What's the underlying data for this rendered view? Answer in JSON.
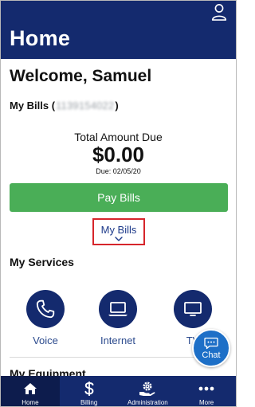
{
  "header": {
    "title": "Home",
    "profile_icon": "person-outline-icon"
  },
  "welcome": "Welcome, Samuel",
  "bills": {
    "section_label": "My Bills (",
    "account_number": "1139154022",
    "section_label_close": ")",
    "total_label": "Total Amount Due",
    "total_amount": "$0.00",
    "due_date": "Due: 02/05/20",
    "pay_button": "Pay Bills",
    "my_bills_link": "My Bills"
  },
  "services": {
    "title": "My Services",
    "items": [
      {
        "label": "Voice",
        "icon": "phone-icon"
      },
      {
        "label": "Internet",
        "icon": "laptop-icon"
      },
      {
        "label": "TV",
        "icon": "tv-icon"
      }
    ]
  },
  "next_section_peek": "My Equipment",
  "chat": {
    "label": "Chat",
    "icon": "chat-bubble-icon"
  },
  "tabbar": {
    "items": [
      {
        "label": "Home",
        "icon": "home-icon",
        "active": true
      },
      {
        "label": "Billing",
        "icon": "dollar-icon",
        "active": false
      },
      {
        "label": "Administration",
        "icon": "admin-gear-hand-icon",
        "active": false
      },
      {
        "label": "More",
        "icon": "more-dots-icon",
        "active": false
      }
    ]
  },
  "colors": {
    "primary_navy": "#142a6e",
    "pay_green": "#4aae57",
    "highlight_red": "#d6252b",
    "chat_blue": "#1d6fc7"
  }
}
